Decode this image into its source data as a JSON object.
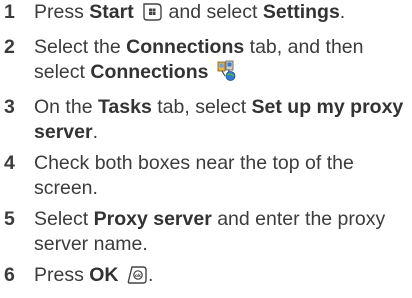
{
  "steps": [
    {
      "number": "1",
      "text_a": "Press ",
      "bold_a": "Start",
      "text_b": " and select ",
      "bold_b": "Settings",
      "text_c": ".",
      "icon": "start-button-icon"
    },
    {
      "number": "2",
      "text_a": "Select the ",
      "bold_a": "Connections",
      "text_b": " tab, and then select ",
      "bold_b": "Connections",
      "icon": "connections-icon"
    },
    {
      "number": "3",
      "text_a": "On the ",
      "bold_a": "Tasks",
      "text_b": " tab, select ",
      "bold_b": "Set up my proxy server",
      "text_c": "."
    },
    {
      "number": "4",
      "text_a": "Check both boxes near the top of the screen."
    },
    {
      "number": "5",
      "text_a": "Select ",
      "bold_a": "Proxy server",
      "text_b": " and enter the proxy server name."
    },
    {
      "number": "6",
      "text_a": "Press ",
      "bold_a": "OK",
      "text_b": ".",
      "icon": "ok-button-icon"
    }
  ]
}
